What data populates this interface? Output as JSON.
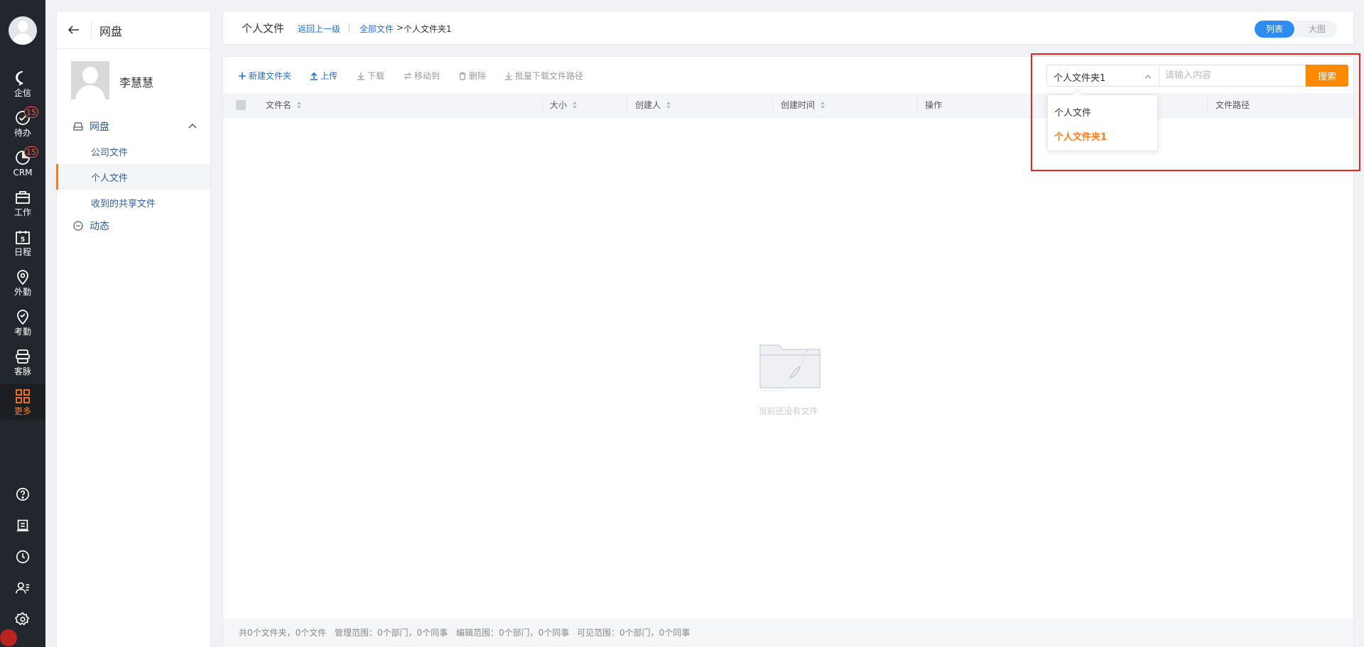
{
  "nav": {
    "items": [
      {
        "key": "qixin",
        "label": "企信"
      },
      {
        "key": "todo",
        "label": "待办",
        "badge": "15"
      },
      {
        "key": "crm",
        "label": "CRM",
        "badge": "15"
      },
      {
        "key": "work",
        "label": "工作"
      },
      {
        "key": "schedule",
        "label": "日程",
        "day": "5"
      },
      {
        "key": "field",
        "label": "外勤"
      },
      {
        "key": "attendance",
        "label": "考勤"
      },
      {
        "key": "customer",
        "label": "客脉"
      },
      {
        "key": "more",
        "label": "更多",
        "active": true
      }
    ],
    "bottom_icons": [
      "help-icon",
      "notes-icon",
      "clock-icon",
      "contacts-icon",
      "settings-icon"
    ]
  },
  "sidebar": {
    "title": "网盘",
    "user_name": "李慧慧",
    "root": "网盘",
    "children": [
      "公司文件",
      "个人文件",
      "收到的共享文件"
    ],
    "active_child": "个人文件",
    "dynamics": "动态"
  },
  "header": {
    "title": "个人文件",
    "back_up": "返回上一级",
    "crumb_all": "全部文件",
    "crumb_sep": ">",
    "crumb_current": "个人文件夹1",
    "view_list": "列表",
    "view_grid": "大图"
  },
  "toolbar": {
    "new_folder": "新建文件夹",
    "upload": "上传",
    "download": "下载",
    "move": "移动到",
    "delete": "删除",
    "batch_download": "批量下载文件路径"
  },
  "search": {
    "scope_value": "个人文件夹1",
    "placeholder": "请输入内容",
    "button": "搜索",
    "options": [
      "个人文件",
      "个人文件夹1"
    ],
    "selected": "个人文件夹1"
  },
  "table": {
    "columns": [
      "文件名",
      "大小",
      "创建人",
      "创建时间",
      "操作",
      "文件路径"
    ],
    "empty_text": "当前还没有文件"
  },
  "footer": {
    "summary": "共0个文件夹，0个文件",
    "manage": "管理范围：0个部门，0个同事",
    "edit": "编辑范围：0个部门，0个同事",
    "visible": "可见范围：0个部门，0个同事"
  },
  "colors": {
    "accent": "#ff7a1a",
    "link": "#1f6fd6",
    "highlight": "#e8261e",
    "toggle": "#2d8cf0"
  }
}
